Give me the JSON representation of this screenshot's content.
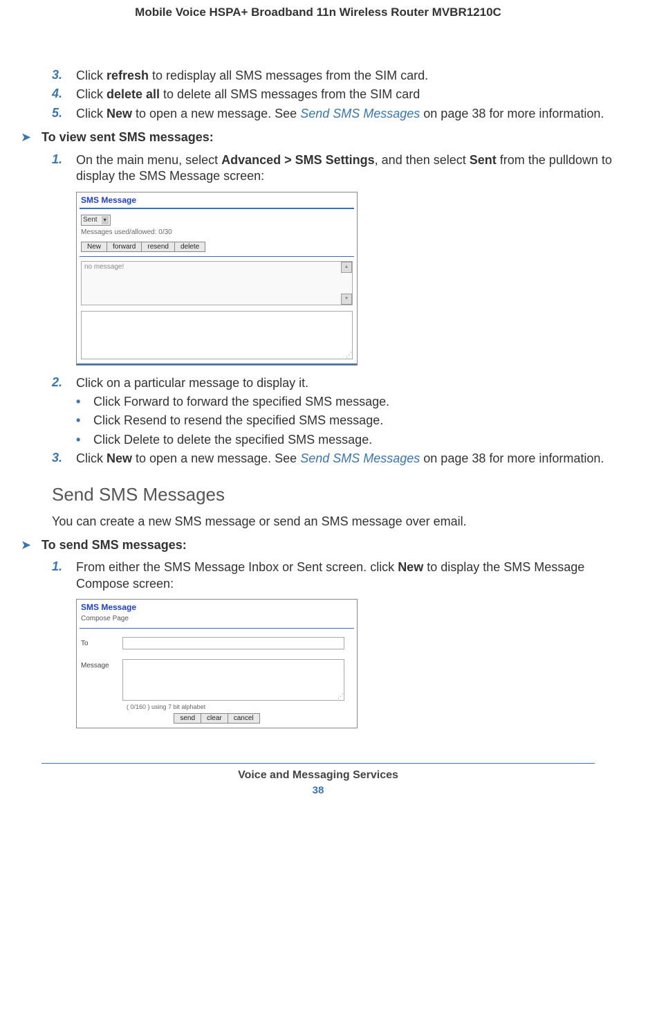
{
  "header": "Mobile Voice HSPA+ Broadband 11n Wireless Router MVBR1210C",
  "steps_a": {
    "s3_num": "3.",
    "s3_pre": "Click ",
    "s3_b": "refresh",
    "s3_post": " to redisplay all SMS messages from the SIM card.",
    "s4_num": "4.",
    "s4_pre": "Click ",
    "s4_b": "delete all",
    "s4_post": " to delete all SMS messages from the SIM card",
    "s5_num": "5.",
    "s5_pre": "Click ",
    "s5_b": "New",
    "s5_mid": " to open a new message. See ",
    "s5_link": "Send SMS Messages",
    "s5_post": " on page 38 for more information."
  },
  "task1_arrow": "➤",
  "task1_text": "To view sent SMS messages:",
  "task1_steps": {
    "s1_num": "1.",
    "s1_pre": "On the main menu, select ",
    "s1_b1": "Advanced > SMS Settings",
    "s1_mid": ", and then select ",
    "s1_b2": "Sent",
    "s1_post": " from the pulldown to display the SMS Message screen:"
  },
  "shot1": {
    "title": "SMS Message",
    "sel_value": "Sent",
    "count": "Messages used/allowed: 0/30",
    "btns": [
      "New",
      "forward",
      "resend",
      "delete"
    ],
    "empty": "no message!"
  },
  "task1_post": {
    "s2_num": "2.",
    "s2_text": "Click on a particular message to display it.",
    "bul1_pre": "Click ",
    "bul1_b": "Forward",
    "bul1_post": " to forward the specified SMS message.",
    "bul2_pre": "Click ",
    "bul2_b": "Resend",
    "bul2_post": " to resend the specified SMS message.",
    "bul3_pre": "Click ",
    "bul3_b": "Delete",
    "bul3_post": " to delete the specified SMS message.",
    "s3_num": "3.",
    "s3_pre": "Click ",
    "s3_b": "New",
    "s3_mid": " to open a new message. See ",
    "s3_link": "Send SMS Messages",
    "s3_post": " on page 38 for more information."
  },
  "section_head": "Send SMS Messages",
  "section_para": "You can create a new SMS message or send an SMS message over email.",
  "task2_arrow": "➤",
  "task2_text": "To send SMS messages:",
  "task2_steps": {
    "s1_num": "1.",
    "s1_pre": "From either the SMS Message Inbox or Sent screen. click ",
    "s1_b": "New",
    "s1_post": " to display the SMS Message Compose screen:"
  },
  "shot2": {
    "title": "SMS Message",
    "compose_label": "Compose Page",
    "to": "To",
    "msg": "Message",
    "counter": "( 0/160 ) using 7 bit alphabet",
    "btns": [
      "send",
      "clear",
      "cancel"
    ]
  },
  "footer": {
    "section": "Voice and Messaging Services",
    "page": "38"
  }
}
